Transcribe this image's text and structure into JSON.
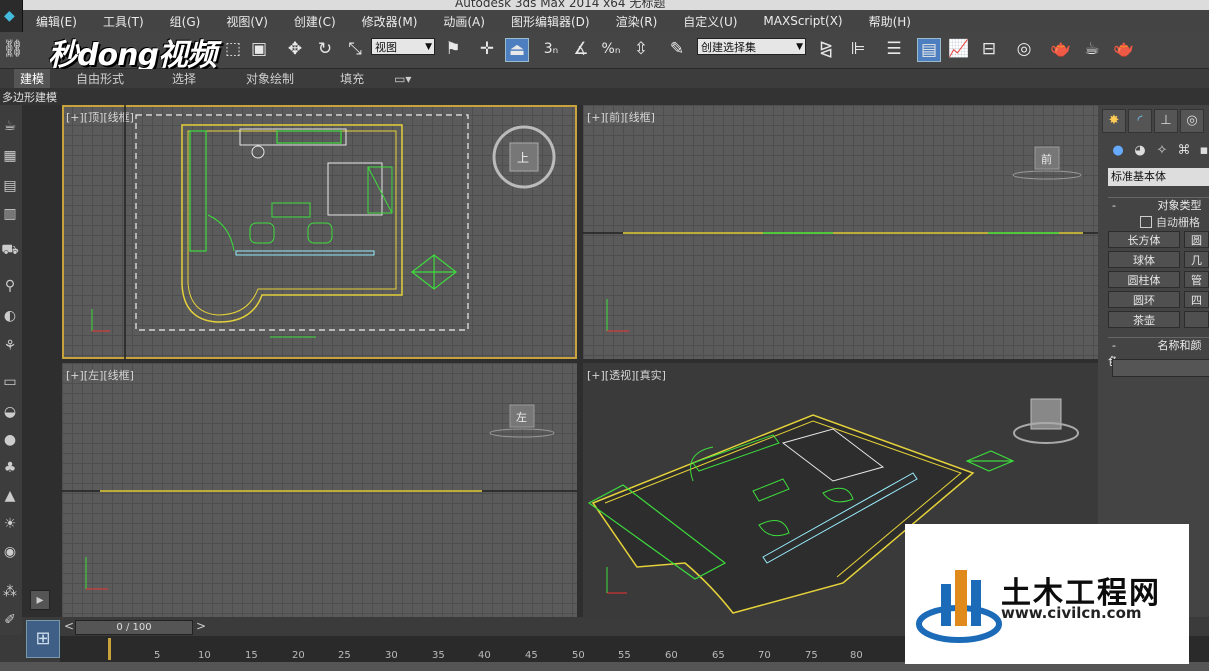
{
  "window": {
    "title": "Autodesk 3ds Max  2014 x64    无标题"
  },
  "menu": [
    "编辑(E)",
    "工具(T)",
    "组(G)",
    "视图(V)",
    "创建(C)",
    "修改器(M)",
    "动画(A)",
    "图形编辑器(D)",
    "渲染(R)",
    "自定义(U)",
    "MAXScript(X)",
    "帮助(H)"
  ],
  "toolbar": {
    "reference_coord": "视图",
    "selection_set": "创建选择集",
    "snap_labels": [
      "3",
      "%"
    ]
  },
  "watermark": "秒dong视频",
  "ribbon": {
    "tabs": [
      "建模",
      "自由形式",
      "选择",
      "对象绘制",
      "填充"
    ],
    "sub_label": "多边形建模"
  },
  "viewports": {
    "top": "[+][顶][线框]",
    "front": "[+][前][线框]",
    "left": "[+][左][线框]",
    "perspective": "[+][透视][真实]",
    "cube_top": "上",
    "cube_front": "前",
    "cube_left": "左"
  },
  "command_panel": {
    "category": "标准基本体",
    "section_object_type": "对象类型",
    "autogrid": "自动栅格",
    "buttons": [
      "长方体",
      "球体",
      "圆柱体",
      "圆环",
      "茶壶"
    ],
    "buttons_right": [
      "圆",
      "几",
      "管",
      "四",
      ""
    ],
    "section_name_color": "名称和颜色"
  },
  "timeline": {
    "frame_counter": "0 / 100",
    "ticks": [
      "5",
      "10",
      "15",
      "20",
      "25",
      "30",
      "35",
      "40",
      "45",
      "50",
      "55",
      "60",
      "65",
      "70",
      "75",
      "80"
    ]
  },
  "ad": {
    "title": "土木工程网",
    "url": "www.civilcn.com"
  },
  "colors": {
    "active_viewport": "#c8a23a",
    "wire_yellow": "#e5d23a",
    "wire_green": "#3ddc3d",
    "wire_white": "#e8e8e8"
  }
}
